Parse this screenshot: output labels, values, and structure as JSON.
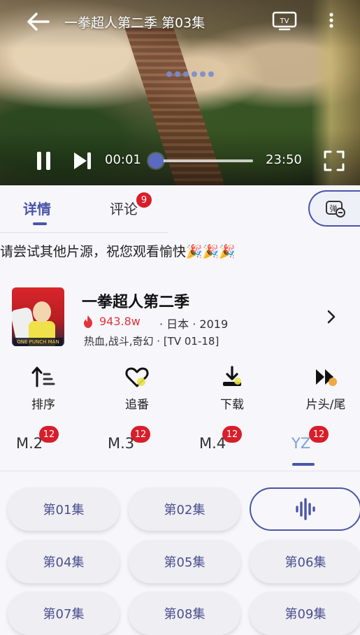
{
  "player": {
    "title": "一拳超人第二季 第03集",
    "current_time": "00:01",
    "total_time": "23:50",
    "progress": 0.001
  },
  "tabs": {
    "detail": "详情",
    "comments": "评论",
    "comments_badge": "9",
    "danmaku_label": "弹"
  },
  "notice": "请尝试其他片源，祝您观看愉快🎉🎉🎉",
  "anime": {
    "poster_text": "ONE PUNCH MAN",
    "title": "一拳超人第二季",
    "views": "943.8w",
    "meta": "· 日本 · 2019",
    "genres": "热血,战斗,奇幻 · [TV 01-18]"
  },
  "actions": [
    {
      "label": "排序",
      "icon": "sort-icon"
    },
    {
      "label": "追番",
      "icon": "heart-icon"
    },
    {
      "label": "下载",
      "icon": "download-icon"
    },
    {
      "label": "片头/尾",
      "icon": "skip-icon"
    }
  ],
  "sources": [
    {
      "label": "M.2",
      "badge": "12"
    },
    {
      "label": "M.3",
      "badge": "12"
    },
    {
      "label": "M.4",
      "badge": "12"
    },
    {
      "label": "YZ",
      "badge": "12",
      "active": true
    }
  ],
  "episodes": [
    {
      "label": "第01集"
    },
    {
      "label": "第02集"
    },
    {
      "label": "",
      "current": true,
      "icon": "audio-wave-icon"
    },
    {
      "label": "第04集"
    },
    {
      "label": "第05集"
    },
    {
      "label": "第06集"
    },
    {
      "label": "第07集"
    },
    {
      "label": "第08集"
    },
    {
      "label": "第09集"
    }
  ],
  "colors": {
    "accent": "#4a55a8",
    "badge": "#d81e2a",
    "views": "#e2343a"
  }
}
